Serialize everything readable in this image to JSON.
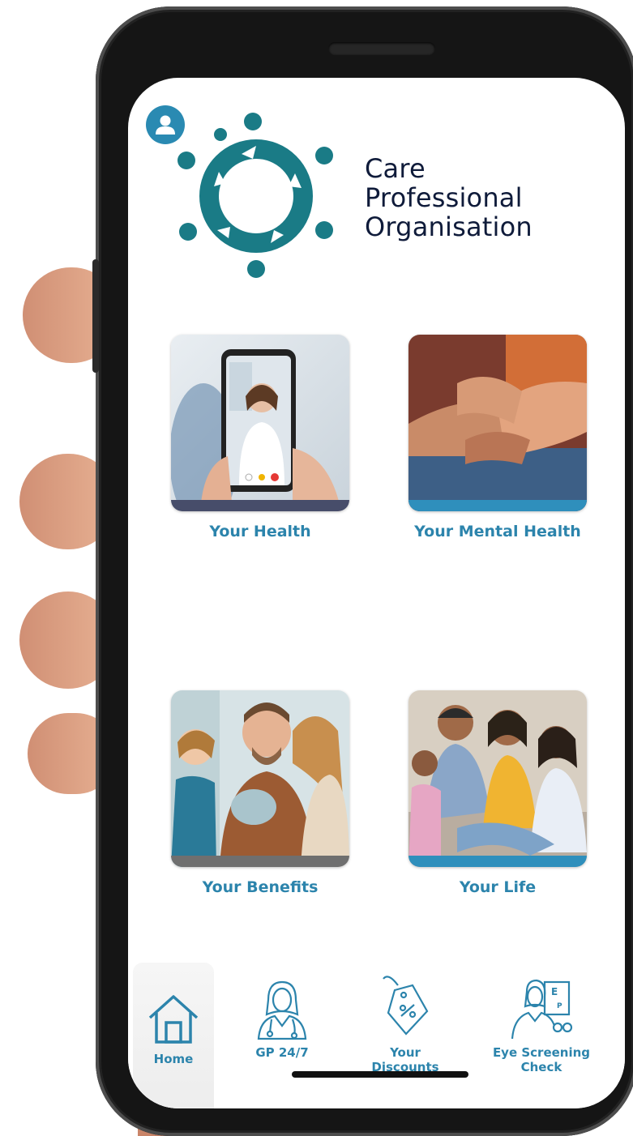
{
  "header": {
    "profile_icon": "user-profile-icon",
    "logo_icon": "people-circle-logo",
    "org_name_lines": [
      "Care",
      "Professional",
      "Organisation"
    ]
  },
  "tiles": [
    {
      "label": "Your Health",
      "image": "video-call-doctor-photo"
    },
    {
      "label": "Your Mental Health",
      "image": "holding-hands-photo"
    },
    {
      "label": "Your Benefits",
      "image": "family-piggy-bank-photo"
    },
    {
      "label": "Your Life",
      "image": "family-on-sofa-photo"
    }
  ],
  "tabbar": {
    "tabs": [
      {
        "label": "Home",
        "icon": "house-icon",
        "selected": true
      },
      {
        "label": "GP 24/7",
        "icon": "doctor-icon"
      },
      {
        "label": "Your Discounts",
        "icon": "price-tag-icon"
      },
      {
        "label": "Eye Screening Check",
        "icon": "optician-icon"
      }
    ]
  },
  "colors": {
    "accent": "#2c84ac",
    "logo_teal": "#1a7b86",
    "org_text": "#0f1b3a",
    "tile_bar_navy": "#474d6a",
    "tile_bar_blue": "#2f8fbc",
    "tile_bar_grey": "#6f6f6f"
  }
}
